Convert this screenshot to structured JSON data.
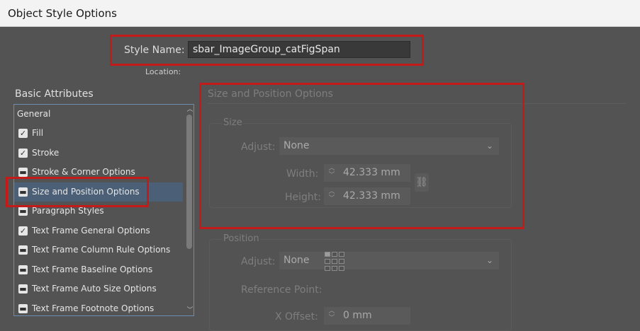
{
  "window": {
    "title": "Object Style Options"
  },
  "style_name": {
    "label": "Style Name:",
    "value": "sbar_ImageGroup_catFigSpan"
  },
  "location": {
    "label": "Location:"
  },
  "basic_attributes": {
    "title": "Basic Attributes",
    "items": [
      {
        "label": "General",
        "checkbox": "none",
        "selected": false
      },
      {
        "label": "Fill",
        "checkbox": "checked",
        "selected": false
      },
      {
        "label": "Stroke",
        "checkbox": "checked",
        "selected": false
      },
      {
        "label": "Stroke & Corner Options",
        "checkbox": "mixed",
        "selected": false
      },
      {
        "label": "Size and Position Options",
        "checkbox": "mixed",
        "selected": true
      },
      {
        "label": "Paragraph Styles",
        "checkbox": "mixed",
        "selected": false
      },
      {
        "label": "Text Frame General Options",
        "checkbox": "checked",
        "selected": false
      },
      {
        "label": "Text Frame Column Rule Options",
        "checkbox": "mixed",
        "selected": false
      },
      {
        "label": "Text Frame Baseline Options",
        "checkbox": "mixed",
        "selected": false
      },
      {
        "label": "Text Frame Auto Size Options",
        "checkbox": "mixed",
        "selected": false
      },
      {
        "label": "Text Frame Footnote Options",
        "checkbox": "mixed",
        "selected": false
      }
    ]
  },
  "size_position": {
    "title": "Size and Position Options",
    "size": {
      "title": "Size",
      "adjust_label": "Adjust:",
      "adjust_value": "None",
      "width_label": "Width:",
      "width_value": "42.333 mm",
      "height_label": "Height:",
      "height_value": "42.333 mm"
    },
    "position": {
      "title": "Position",
      "adjust_label": "Adjust:",
      "adjust_value": "None",
      "ref_point_label": "Reference Point:",
      "x_offset_label": "X Offset:",
      "x_offset_value": "0 mm"
    }
  },
  "colors": {
    "highlight": "#c41a1a",
    "selection": "#4b5f77",
    "background": "#535353"
  }
}
